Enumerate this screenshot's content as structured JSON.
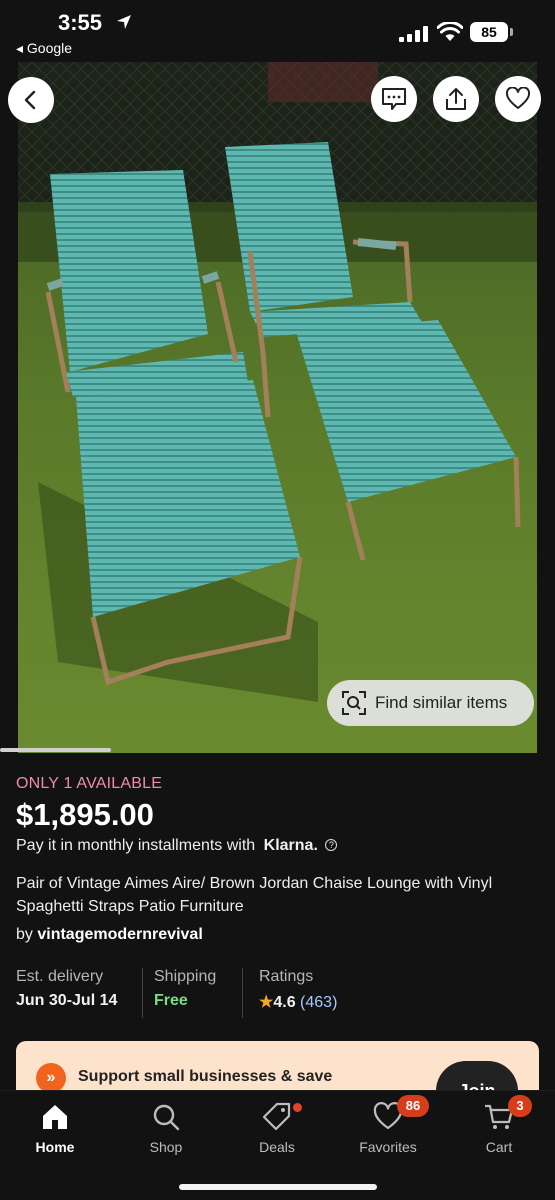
{
  "status_bar": {
    "time": "3:55",
    "back_app": "◂ Google",
    "battery": "85"
  },
  "listing": {
    "availability": "ONLY 1 AVAILABLE",
    "price": "$1,895.00",
    "installments_text": "Pay it in monthly installments with",
    "klarna_brand": "Klarna.",
    "title": "Pair of Vintage Aimes Aire/ Brown Jordan Chaise Lounge with Vinyl Spaghetti Straps Patio Furniture",
    "seller_prefix": "by",
    "seller_name": "vintagemodernrevival",
    "find_similar": "Find similar items",
    "facts": {
      "delivery_label": "Est. delivery",
      "delivery_value": "Jun 30-Jul 14",
      "shipping_label": "Shipping",
      "shipping_value": "Free",
      "ratings_label": "Ratings",
      "rating_value": "4.6",
      "rating_count": "(463)"
    }
  },
  "banner": {
    "text": "Support small businesses & save",
    "join_label": "Join"
  },
  "tabs": [
    {
      "label": "Home",
      "icon": "home-icon",
      "active": true
    },
    {
      "label": "Shop",
      "icon": "search-icon"
    },
    {
      "label": "Deals",
      "icon": "tag-icon"
    },
    {
      "label": "Favorites",
      "icon": "heart-icon",
      "badge": "86"
    },
    {
      "label": "Cart",
      "icon": "cart-icon",
      "badge": "3"
    }
  ],
  "colors": {
    "background": "#121212",
    "availability": "#f08ca4",
    "free_shipping": "#7ed98a",
    "banner": "#fde3cc",
    "badge": "#d63e1b",
    "etsy_orange": "#f1641e"
  }
}
